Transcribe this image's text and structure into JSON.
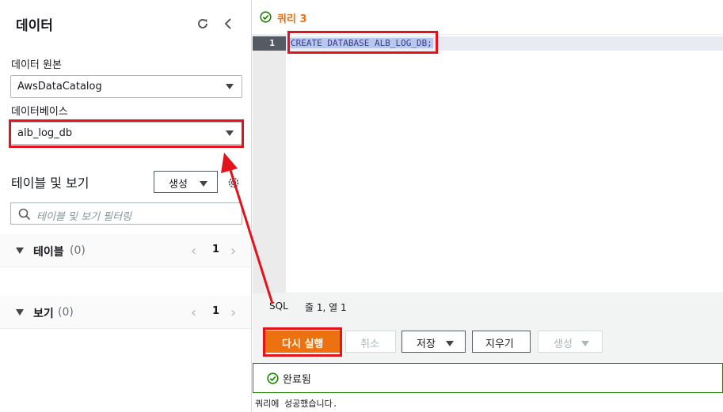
{
  "left_panel": {
    "title": "데이터",
    "data_source_label": "데이터 원본",
    "data_source_value": "AwsDataCatalog",
    "database_label": "데이터베이스",
    "database_value": "alb_log_db",
    "tables_views_title": "테이블 및 보기",
    "create_button_label": "생성",
    "filter_placeholder": "테이블 및 보기 필터링",
    "tables_group": {
      "label": "테이블",
      "count": "(0)",
      "page": "1"
    },
    "views_group": {
      "label": "보기",
      "count": "(0)",
      "page": "1"
    }
  },
  "query_tab": {
    "name": "쿼리 3",
    "status_color": "#1d8102",
    "tab_color": "#ec7211"
  },
  "editor": {
    "line_number": "1",
    "code": "CREATE DATABASE ALB_LOG_DB;"
  },
  "status_bar": {
    "language": "SQL",
    "position": "줄 1, 열 1"
  },
  "actions": {
    "run_again": "다시 실행",
    "cancel": "취소",
    "save": "저장",
    "clear": "지우기",
    "create": "생성"
  },
  "result": {
    "status": "완료됨",
    "message": "쿼리에 성공했습니다."
  },
  "annotation_color": "#e3131c"
}
